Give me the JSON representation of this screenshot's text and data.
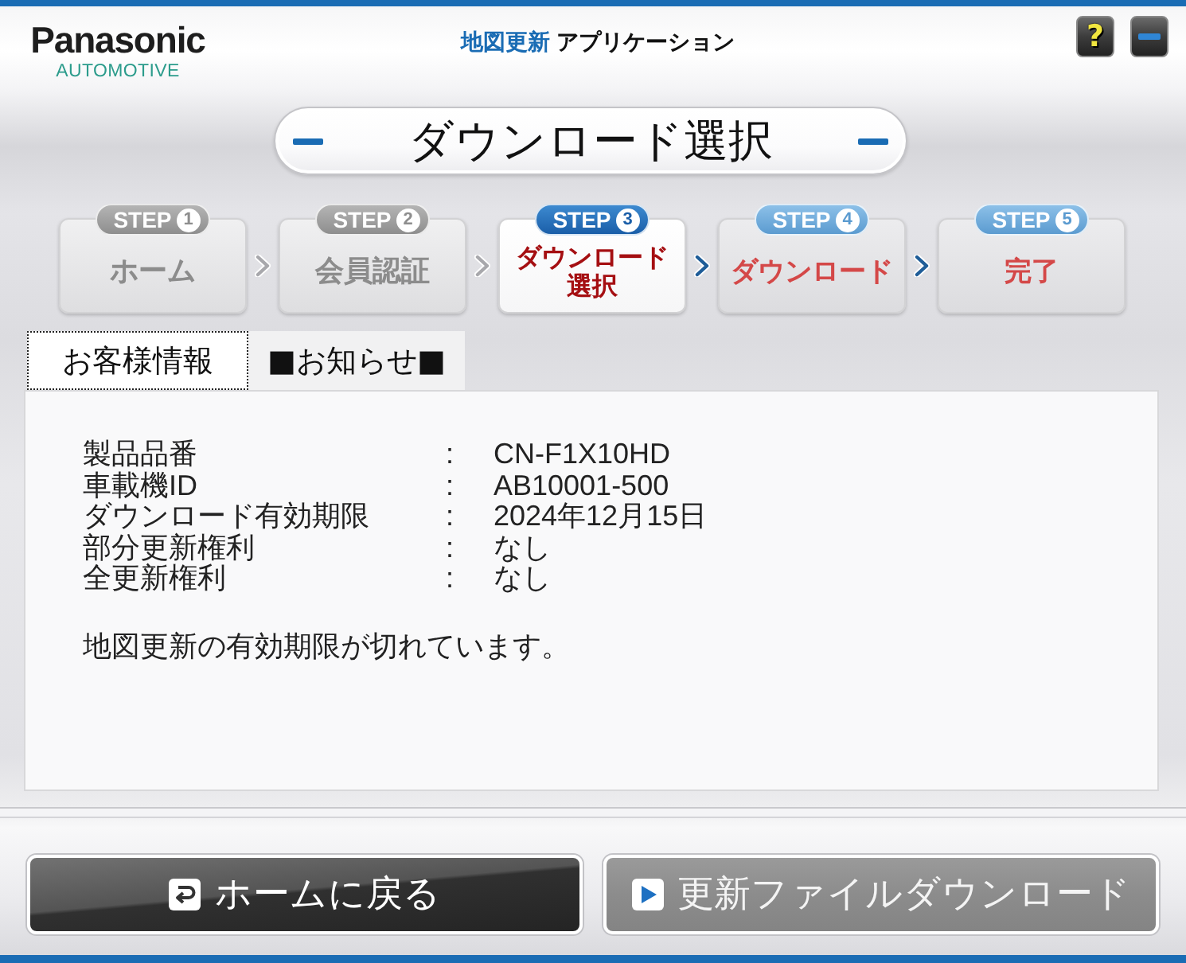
{
  "header": {
    "logo": "Panasonic",
    "logo_subtitle": "AUTOMOTIVE",
    "app_title_highlight": "地図更新",
    "app_title": "アプリケーション",
    "controls": [
      {
        "kind": "help",
        "label": "?"
      },
      {
        "kind": "minimize"
      }
    ]
  },
  "page_title": "ダウンロード選択",
  "steps": [
    {
      "badge": "STEP",
      "number": "1",
      "label": "ホーム",
      "completed": true,
      "selected": false
    },
    {
      "badge": "STEP",
      "number": "2",
      "label": "会員認証",
      "completed": true,
      "selected": false
    },
    {
      "badge": "STEP",
      "number": "3",
      "label": "ダウンロード選択",
      "completed": false,
      "selected": true
    },
    {
      "badge": "STEP",
      "number": "4",
      "label": "ダウンロード",
      "completed": false,
      "selected": false
    },
    {
      "badge": "STEP",
      "number": "5",
      "label": "完了",
      "completed": false,
      "selected": false
    }
  ],
  "tabs": [
    {
      "label": "お客様情報",
      "selected": true
    },
    {
      "label": "■お知らせ■",
      "selected": false
    }
  ],
  "info_rows": [
    {
      "label": "製品品番",
      "separator": ":",
      "value": "CN-F1X10HD"
    },
    {
      "label": "車載機ID",
      "separator": ":",
      "value": "AB10001-500"
    },
    {
      "label": "ダウンロード有効期限",
      "separator": ":",
      "value": "2024年12月15日"
    },
    {
      "label": "部分更新権利",
      "separator": ":",
      "value": "なし"
    },
    {
      "label": "全更新権利",
      "separator": ":",
      "value": "なし"
    }
  ],
  "message": "地図更新の有効期限が切れています。",
  "buttons": [
    {
      "kind": "back",
      "label": "ホームに戻る",
      "disabled": false
    },
    {
      "kind": "play",
      "label": "更新ファイルダウンロード",
      "disabled": true
    }
  ]
}
